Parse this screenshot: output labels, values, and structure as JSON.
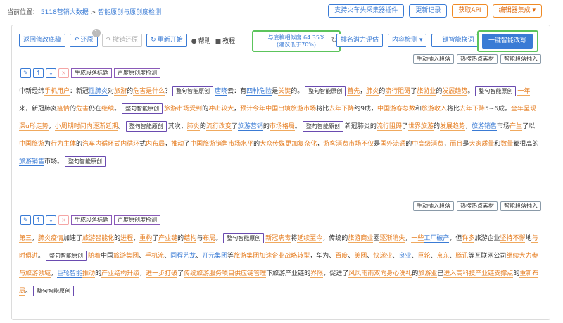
{
  "breadcrumb": {
    "prefix": "当前位置：",
    "items": [
      "5118营销大数据",
      ">",
      "智能原创与原创度检测"
    ]
  },
  "top_buttons": [
    "支持火车头采集器插件",
    "更新记录",
    "获取API",
    "编辑器集成"
  ],
  "toolbar": {
    "back_label": "返回修改底稿",
    "restore_label": "还原",
    "restore_badge": "1",
    "undo_restore_label": "撤销还原",
    "restart_label": "重新开始",
    "help_label": "帮助",
    "tutorial_label": "教程"
  },
  "similarity": {
    "line1": "与底稿相似度 64.35%",
    "line2": "(建议低于70%)"
  },
  "right_buttons": [
    "排名潜力评估",
    "内容检测",
    "一键智能换词"
  ],
  "rewrite_label": "一键智能改写",
  "para_tags": [
    "手动插入段落",
    "热搜热点素材",
    "智能段落插入"
  ],
  "para_tools": {
    "gen_title": "生成段落标题",
    "check": "百度原创度检测",
    "icons": [
      "edit-icon",
      "arrow-up-icon",
      "arrow-down-icon",
      "close-icon"
    ]
  },
  "chip_label": "整句智能原创",
  "accent_colors": {
    "blue": "#3a7bd5",
    "orange": "#e67e22",
    "green": "#5cc45c",
    "purple": "#6a4bb0"
  },
  "paragraph1": [
    [
      "t",
      "中新经纬"
    ],
    [
      "o",
      "手机用户"
    ],
    [
      "t",
      "：新冠"
    ],
    [
      "b",
      "性肺炎"
    ],
    [
      "t",
      "对"
    ],
    [
      "o",
      "旅游"
    ],
    [
      "t",
      "的"
    ],
    [
      "o",
      "危害是什么"
    ],
    [
      "t",
      "？"
    ],
    [
      "c",
      "整句智能原创"
    ],
    [
      "b",
      "唐晓"
    ],
    [
      "t",
      "云：有"
    ],
    [
      "b",
      "四种危险"
    ],
    [
      "t",
      "是"
    ],
    [
      "o",
      "关键"
    ],
    [
      "t",
      "的。"
    ],
    [
      "c",
      "整句智能原创"
    ],
    [
      "o",
      "首先"
    ],
    [
      "t",
      "，"
    ],
    [
      "o",
      "肺炎"
    ],
    [
      "t",
      "的"
    ],
    [
      "o",
      "流行阻碍"
    ],
    [
      "t",
      "了"
    ],
    [
      "o",
      "旅游业"
    ],
    [
      "t",
      "的"
    ],
    [
      "o",
      "发展趋势"
    ],
    [
      "t",
      "。"
    ],
    [
      "c",
      "整句智能原创"
    ],
    [
      "o",
      "一年"
    ],
    [
      "t",
      "来，新冠肺炎"
    ],
    [
      "o",
      "疫情"
    ],
    [
      "t",
      "的"
    ],
    [
      "o",
      "危害"
    ],
    [
      "t",
      "仍在"
    ],
    [
      "o",
      "继续"
    ],
    [
      "t",
      "。"
    ],
    [
      "c",
      "整句智能原创"
    ],
    [
      "o",
      "旅游市场受到"
    ],
    [
      "t",
      "的"
    ],
    [
      "o",
      "冲击较大"
    ],
    [
      "t",
      "，"
    ],
    [
      "o",
      "预计今年中国出境旅游市场"
    ],
    [
      "t",
      "将比"
    ],
    [
      "o",
      "去年下降"
    ],
    [
      "t",
      "约9成，"
    ],
    [
      "o",
      "中国游客总数"
    ],
    [
      "t",
      "和"
    ],
    [
      "o",
      "旅游收入"
    ],
    [
      "t",
      "将比"
    ],
    [
      "o",
      "去年下降"
    ],
    [
      "t",
      "5~6成。"
    ],
    [
      "o",
      "全年呈现深u形走势"
    ],
    [
      "t",
      "，"
    ],
    [
      "o",
      "小周期时间内逐渐"
    ],
    [
      "o",
      "延期"
    ],
    [
      "t",
      "。"
    ],
    [
      "c",
      "整句智能原创"
    ],
    [
      "t",
      "其次，"
    ],
    [
      "o",
      "肺炎"
    ],
    [
      "t",
      "的"
    ],
    [
      "o",
      "流行改变"
    ],
    [
      "t",
      "了"
    ],
    [
      "b",
      "旅游营销"
    ],
    [
      "t",
      "的"
    ],
    [
      "o",
      "市场格局"
    ],
    [
      "t",
      "。"
    ],
    [
      "c",
      "整句智能原创"
    ],
    [
      "t",
      "新冠肺炎的"
    ],
    [
      "o",
      "流行阻碍"
    ],
    [
      "t",
      "了"
    ],
    [
      "o",
      "世界旅游"
    ],
    [
      "t",
      "的"
    ],
    [
      "o",
      "发展趋势"
    ],
    [
      "t",
      "，"
    ],
    [
      "b",
      "旅游销售"
    ],
    [
      "t",
      "市场"
    ],
    [
      "o",
      "产生"
    ],
    [
      "t",
      "了以"
    ],
    [
      "o",
      "中国旅游"
    ],
    [
      "t",
      "为"
    ],
    [
      "o",
      "行为主体"
    ],
    [
      "t",
      "的"
    ],
    [
      "o",
      "汽车内循环式内循环"
    ],
    [
      "t",
      "式"
    ],
    [
      "o",
      "内布局"
    ],
    [
      "t",
      "，"
    ],
    [
      "o",
      "推动"
    ],
    [
      "t",
      "了"
    ],
    [
      "o",
      "中国旅游销售市场水平"
    ],
    [
      "t",
      "的"
    ],
    [
      "o",
      "大众传媒更加复杂化"
    ],
    [
      "t",
      "，"
    ],
    [
      "o",
      "游客"
    ],
    [
      "o",
      "消费市场不仅"
    ],
    [
      "t",
      "是"
    ],
    [
      "o",
      "国外流通"
    ],
    [
      "t",
      "的"
    ],
    [
      "o",
      "中高级消费"
    ],
    [
      "t",
      "，"
    ],
    [
      "o",
      "而且"
    ],
    [
      "t",
      "是"
    ],
    [
      "o",
      "大家质量"
    ],
    [
      "t",
      "和"
    ],
    [
      "o",
      "数量"
    ],
    [
      "t",
      "都很高的"
    ],
    [
      "b",
      "旅游销售"
    ],
    [
      "t",
      "市场。"
    ],
    [
      "c",
      "整句智能原创"
    ]
  ],
  "paragraph2": [
    [
      "o",
      "第三"
    ],
    [
      "t",
      "，"
    ],
    [
      "o",
      "肺炎疫情"
    ],
    [
      "t",
      "加速了"
    ],
    [
      "o",
      "旅游智能化"
    ],
    [
      "t",
      "的"
    ],
    [
      "o",
      "进程"
    ],
    [
      "t",
      "，"
    ],
    [
      "o",
      "重构"
    ],
    [
      "t",
      "了"
    ],
    [
      "o",
      "产业链"
    ],
    [
      "t",
      "的"
    ],
    [
      "o",
      "结构"
    ],
    [
      "t",
      "与"
    ],
    [
      "o",
      "布局"
    ],
    [
      "t",
      "。"
    ],
    [
      "c",
      "整句智能原创"
    ],
    [
      "o",
      "新冠病毒"
    ],
    [
      "t",
      "将"
    ],
    [
      "o",
      "延续至今"
    ],
    [
      "t",
      "，传统的"
    ],
    [
      "o",
      "旅游商业"
    ],
    [
      "t",
      "圈"
    ],
    [
      "o",
      "逐渐消失"
    ],
    [
      "t",
      "，"
    ],
    [
      "o",
      "一些"
    ],
    [
      "b",
      "工厂破产"
    ],
    [
      "t",
      "，但"
    ],
    [
      "o",
      "许多"
    ],
    [
      "t",
      "旅游企业"
    ],
    [
      "o",
      "坚持不懈"
    ],
    [
      "t",
      "地"
    ],
    [
      "o",
      "与时俱进"
    ],
    [
      "t",
      "。"
    ],
    [
      "c",
      "整句智能原创"
    ],
    [
      "o",
      "随着"
    ],
    [
      "t",
      "中国"
    ],
    [
      "o",
      "旅游集团"
    ],
    [
      "t",
      "、"
    ],
    [
      "o",
      "手机流"
    ],
    [
      "t",
      "、"
    ],
    [
      "b",
      "同程艺龙"
    ],
    [
      "t",
      "、"
    ],
    [
      "b",
      "开元集团"
    ],
    [
      "t",
      "等"
    ],
    [
      "o",
      "旅游集团加速企业战略转型"
    ],
    [
      "t",
      "，华为、"
    ],
    [
      "o",
      "百度"
    ],
    [
      "t",
      "、"
    ],
    [
      "o",
      "美团"
    ],
    [
      "t",
      "、"
    ],
    [
      "o",
      "快递业"
    ],
    [
      "t",
      "、"
    ],
    [
      "b",
      "良业"
    ],
    [
      "t",
      "、"
    ],
    [
      "o",
      "巨轮"
    ],
    [
      "t",
      "、"
    ],
    [
      "o",
      "京东"
    ],
    [
      "t",
      "、"
    ],
    [
      "o",
      "腾讯"
    ],
    [
      "t",
      "等互联网公司"
    ],
    [
      "o",
      "继续大力参与旅游领域"
    ],
    [
      "t",
      "，"
    ],
    [
      "b",
      "巨轮智能"
    ],
    [
      "o",
      "推动"
    ],
    [
      "t",
      "的"
    ],
    [
      "o",
      "产业结构升级"
    ],
    [
      "t",
      "，"
    ],
    [
      "o",
      "进一步打破"
    ],
    [
      "t",
      "了"
    ],
    [
      "o",
      "传统旅游服务项目供应链管理"
    ],
    [
      "t",
      "下旅游产业链的"
    ],
    [
      "o",
      "界限"
    ],
    [
      "t",
      "，"
    ],
    [
      "t",
      "促进了"
    ],
    [
      "o",
      "风风雨雨双向身心洗礼"
    ],
    [
      "t",
      "的"
    ],
    [
      "o",
      "旅游业"
    ],
    [
      "t",
      "已"
    ],
    [
      "o",
      "进入高科技产业链支撑点"
    ],
    [
      "t",
      "的"
    ],
    [
      "o",
      "重新布局"
    ],
    [
      "t",
      "。"
    ],
    [
      "c",
      "整句智能原创"
    ]
  ]
}
